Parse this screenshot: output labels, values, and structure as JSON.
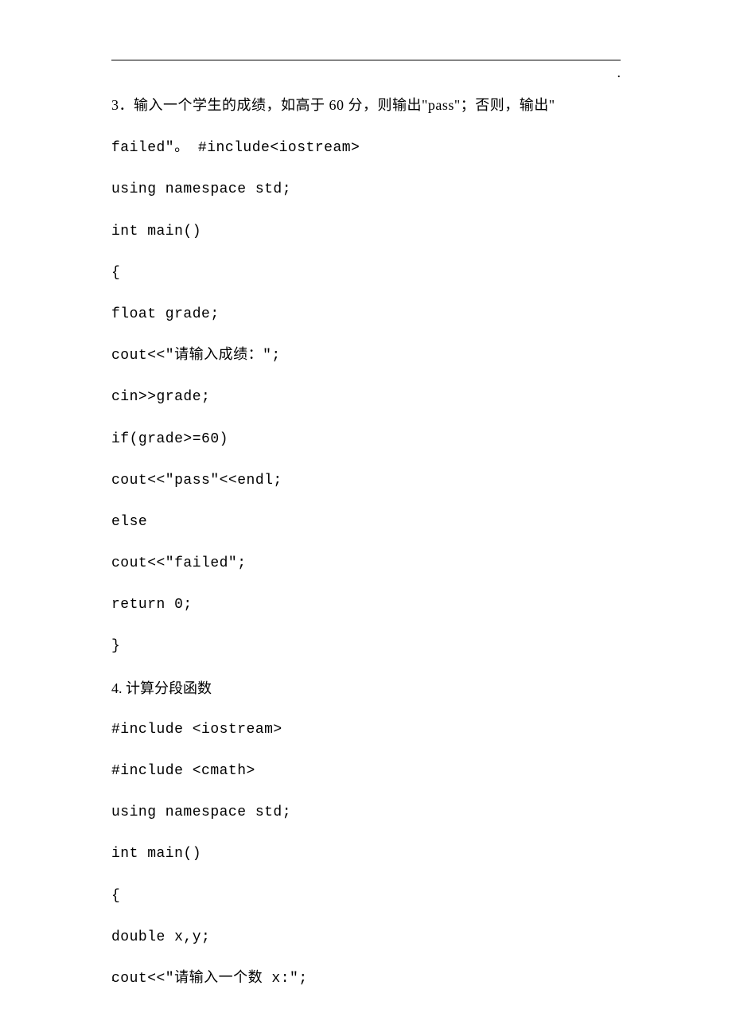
{
  "topDot": ".",
  "q3": {
    "prompt_prefix": "3．输入一个学生的成绩，如高于 60 分，则输出\"pass\"；否则，输出\"",
    "prompt_cont": "failed\"。 #include<iostream>",
    "lines": [
      "using namespace std;",
      "int main()",
      "{",
      "float grade;",
      "cout<<\"请输入成绩：\";",
      "cin>>grade;",
      "if(grade>=60)",
      "cout<<\"pass\"<<endl;",
      "else",
      "cout<<\"failed\";",
      "return 0;",
      "}"
    ]
  },
  "q4": {
    "title": "4. 计算分段函数",
    "lines": [
      "#include <iostream>",
      "#include <cmath>",
      "using namespace std;",
      "int main()",
      "{",
      "double x,y;",
      "cout<<\"请输入一个数 x:\";"
    ]
  },
  "footerDot": "."
}
